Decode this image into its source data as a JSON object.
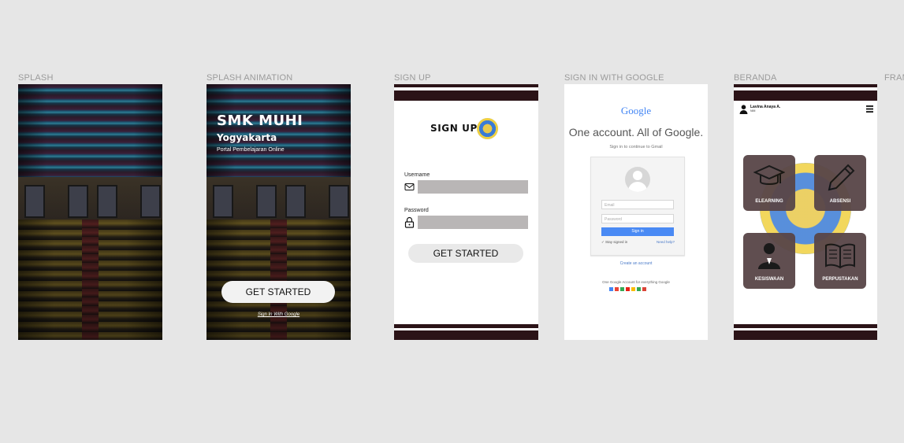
{
  "frames": {
    "splash": {
      "label": "SPLASH"
    },
    "splash_animation": {
      "label": "SPLASH ANIMATION",
      "title": "SMK MUHI",
      "subtitle": "Yogyakarta",
      "tagline": "Portal Pembelajaran Online",
      "get_started": "GET STARTED",
      "google_link": "Sign In With Google"
    },
    "sign_up": {
      "label": "SIGN UP",
      "title": "SIGN UP",
      "username_label": "Username",
      "password_label": "Password",
      "get_started": "GET STARTED"
    },
    "sign_in_google": {
      "label": "SIGN IN WITH GOOGLE",
      "logo": "Google",
      "heading": "One account. All of Google.",
      "subheading": "Sign in to continue to Gmail",
      "email_placeholder": "Email",
      "password_placeholder": "Password",
      "sign_in": "Sign in",
      "stay_signed_in": "Stay signed in",
      "need_help": "Need help?",
      "create_account": "Create an account",
      "footer": "One Google Account for everything Google"
    },
    "beranda": {
      "label": "BERANDA",
      "user_name": "Lavina Anaya A.",
      "user_id": "NIM",
      "menu": [
        "ELEARNING",
        "ABSENSI",
        "KESISWAAN",
        "PERPUSTAKAN"
      ]
    },
    "next": {
      "label": "FRAM"
    }
  },
  "colors": {
    "canvas": "#e6e6e6",
    "bar": "#2b1317",
    "card": "#5a4749",
    "google_blue": "#4a8af4"
  }
}
